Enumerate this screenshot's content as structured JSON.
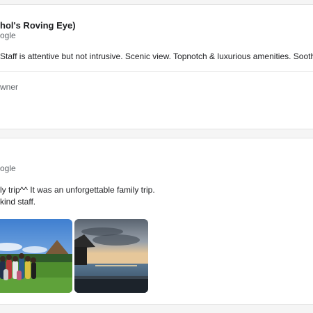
{
  "reviews": [
    {
      "reviewer": "hol's Roving Eye)",
      "source": "ogle",
      "text": "Staff is attentive but not intrusive. Scenic view. Topnotch & luxurious amenities. Soothin",
      "owner_label": "wner"
    },
    {
      "source": "ogle",
      "text_line1": "ly trip^^ It was an unforgettable family trip.",
      "text_line2": "kind staff.",
      "photos": [
        {
          "description": "family group photo on lawn"
        },
        {
          "description": "sunset over infinity pool"
        }
      ]
    }
  ],
  "colors": {
    "page_bg": "#f5f5f5",
    "card_bg": "#ffffff",
    "muted_text": "#5f6368"
  }
}
